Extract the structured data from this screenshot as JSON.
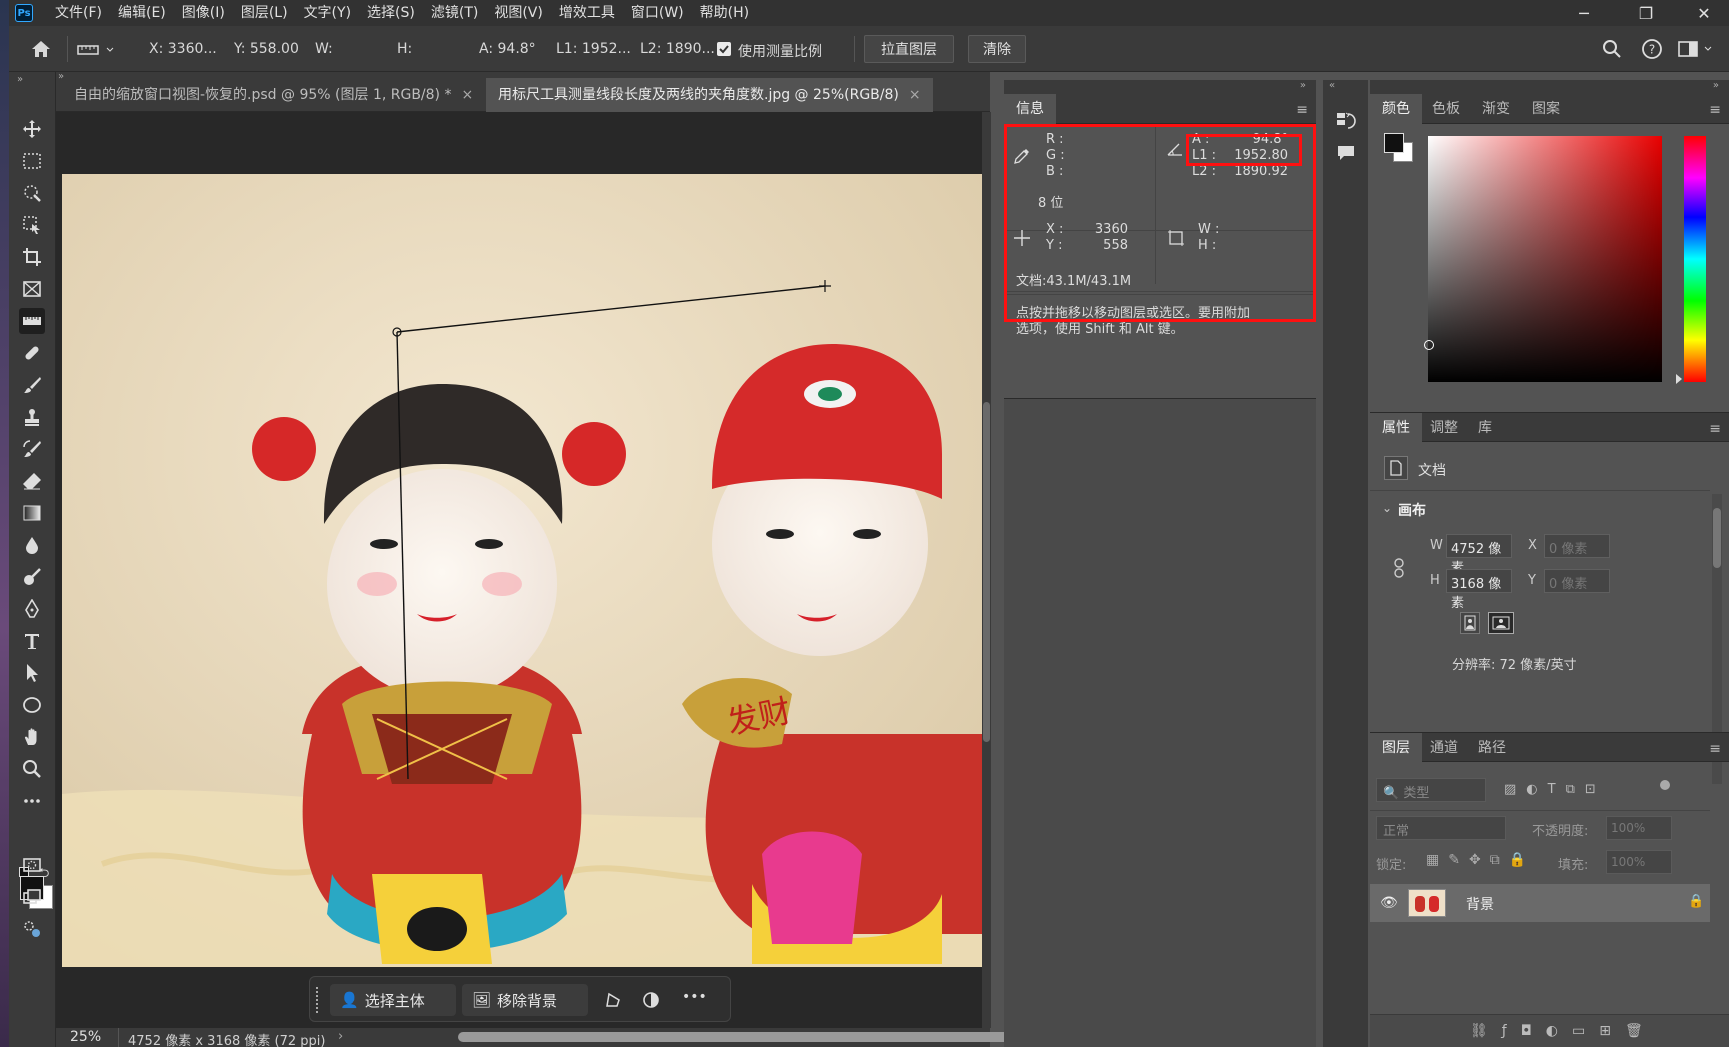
{
  "app": {
    "logo": "Ps"
  },
  "menu": [
    "文件(F)",
    "编辑(E)",
    "图像(I)",
    "图层(L)",
    "文字(Y)",
    "选择(S)",
    "滤镜(T)",
    "视图(V)",
    "增效工具",
    "窗口(W)",
    "帮助(H)"
  ],
  "window_controls": {
    "minimize": "─",
    "restore": "❐",
    "close": "✕"
  },
  "options": {
    "x": "X: 3360...",
    "y": "Y: 558.00",
    "w": "W:",
    "h": "H:",
    "a": "A: 94.8°",
    "l1": "L1: 1952...",
    "l2": "L2: 1890...",
    "use_scale_label": "使用测量比例",
    "use_scale_checked": true,
    "straighten_button": "拉直图层",
    "clear_button": "清除"
  },
  "tabs": [
    {
      "label": "自由的缩放窗口视图-恢复的.psd @ 95% (图层 1, RGB/8) *",
      "active": false,
      "close": "×"
    },
    {
      "label": "用标尺工具测量线段长度及两线的夹角度数.jpg @ 25%(RGB/8)",
      "active": true,
      "close": "×"
    }
  ],
  "contextual_bar": {
    "select_subject": "选择主体",
    "remove_bg": "移除背景",
    "more": "•••"
  },
  "image_text": "发财",
  "status": {
    "zoom": "25%",
    "doc_info": "4752 像素 x 3168 像素 (72 ppi)",
    "arrow": "›"
  },
  "info_panel": {
    "tab": "信息",
    "r_label": "R :",
    "g_label": "G :",
    "b_label": "B :",
    "bits": "8 位",
    "a_label": "A :",
    "a_value": "94.8°",
    "l1_label": "L1 :",
    "l1_value": "1952.80",
    "l2_label": "L2 :",
    "l2_value": "1890.92",
    "x_label": "X :",
    "x_value": "3360",
    "y_label": "Y :",
    "y_value": "558",
    "w_label": "W :",
    "h_label": "H :",
    "doc": "文档:43.1M/43.1M",
    "hint_line1": "点按并拖移以移动图层或选区。要用附加",
    "hint_line2": "选项，使用 Shift 和 Alt 键。"
  },
  "color_panel": {
    "tabs": [
      "颜色",
      "色板",
      "渐变",
      "图案"
    ]
  },
  "properties_panel": {
    "tabs": [
      "属性",
      "调整",
      "库"
    ],
    "type_label": "文档",
    "section": "画布",
    "w_label": "W",
    "w_value": "4752 像素",
    "h_label": "H",
    "h_value": "3168 像素",
    "x_label": "X",
    "x_value": "0 像素",
    "y_label": "Y",
    "y_value": "0 像素",
    "resolution": "分辨率: 72 像素/英寸"
  },
  "layers_panel": {
    "tabs": [
      "图层",
      "通道",
      "路径"
    ],
    "filter_placeholder": "类型",
    "blend_mode": "正常",
    "opacity_label": "不透明度:",
    "opacity_value": "100%",
    "lock_label": "锁定:",
    "fill_label": "填充:",
    "fill_value": "100%",
    "layer_name": "背景"
  },
  "colors": {
    "accent_red": "#ff1010",
    "panel_bg": "#535353",
    "dark_bg": "#3a3a3a"
  }
}
